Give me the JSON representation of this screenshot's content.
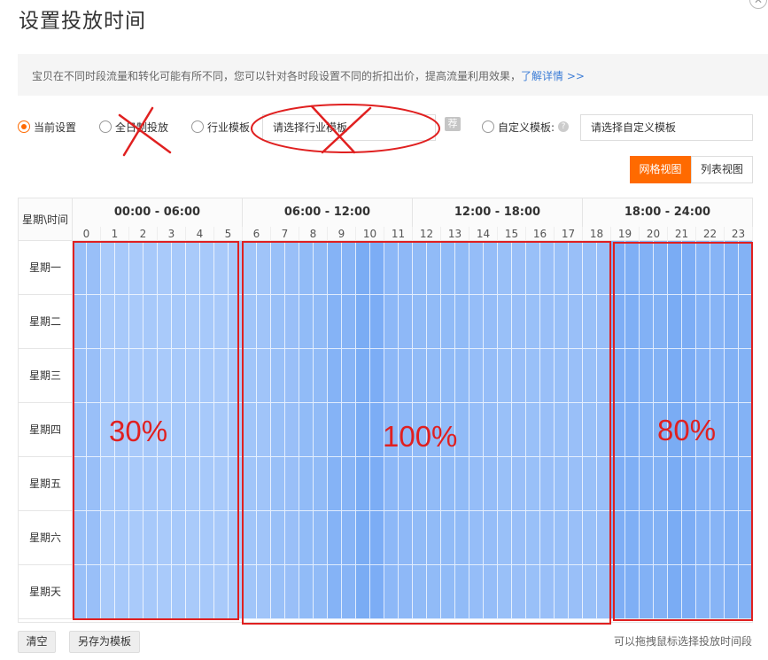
{
  "dialog": {
    "title": "设置投放时间",
    "close_icon": "close-icon"
  },
  "notice": {
    "text": "宝贝在不同时段流量和转化可能有所不同，您可以针对各时段设置不同的折扣出价，提高流量利用效果，",
    "link": "了解详情 >>"
  },
  "options": {
    "current": "当前设置",
    "all_day": "全日制投放",
    "industry": "行业模板",
    "industry_placeholder": "请选择行业模板",
    "recommend_badge": "荐",
    "custom": "自定义模板:",
    "custom_placeholder": "请选择自定义模板",
    "selected": "current"
  },
  "view_toggle": {
    "grid": "网格视图",
    "list": "列表视图",
    "active": "grid"
  },
  "grid": {
    "corner": "星期\\时间",
    "blocks": [
      "00:00 - 06:00",
      "06:00 - 12:00",
      "12:00 - 18:00",
      "18:00 - 24:00"
    ],
    "hours": [
      "0",
      "1",
      "2",
      "3",
      "4",
      "5",
      "6",
      "7",
      "8",
      "9",
      "10",
      "11",
      "12",
      "13",
      "14",
      "15",
      "16",
      "17",
      "18",
      "19",
      "20",
      "21",
      "22",
      "23"
    ],
    "days": [
      "星期一",
      "星期二",
      "星期三",
      "星期四",
      "星期五",
      "星期六",
      "星期天"
    ],
    "hour_levels": [
      0.45,
      0.25,
      0.25,
      0.25,
      0.25,
      0.25,
      0.35,
      0.45,
      0.55,
      0.7,
      0.85,
      0.6,
      0.55,
      0.55,
      0.5,
      0.45,
      0.45,
      0.45,
      0.45,
      0.8,
      0.75,
      0.85,
      0.7,
      0.75
    ],
    "colors": {
      "light": "#bcd6fc",
      "dark": "#6ea4f3"
    }
  },
  "annotations": {
    "pct_morning": "30%",
    "pct_day": "100%",
    "pct_evening": "80%",
    "color": "#e02020"
  },
  "footer": {
    "clear": "清空",
    "save_template": "另存为模板",
    "hint": "可以拖拽鼠标选择投放时间段"
  }
}
